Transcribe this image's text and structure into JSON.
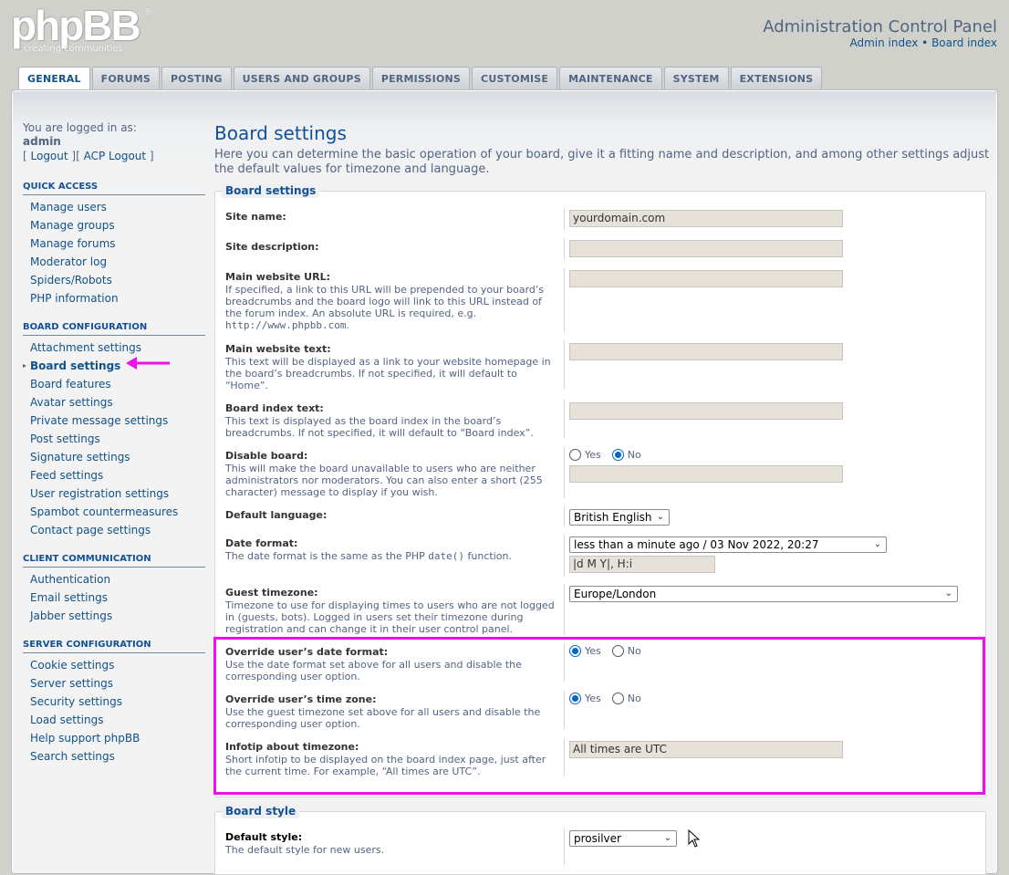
{
  "header": {
    "logo_text": "phpBB",
    "logo_tagline": "creating  communities",
    "logo_reg": "®",
    "title": "Administration Control Panel",
    "admin_index": "Admin index",
    "link_sep": "•",
    "board_index": "Board index"
  },
  "tabs": [
    {
      "label": "GENERAL",
      "active": true
    },
    {
      "label": "FORUMS"
    },
    {
      "label": "POSTING"
    },
    {
      "label": "USERS AND GROUPS"
    },
    {
      "label": "PERMISSIONS"
    },
    {
      "label": "CUSTOMISE"
    },
    {
      "label": "MAINTENANCE"
    },
    {
      "label": "SYSTEM"
    },
    {
      "label": "EXTENSIONS"
    }
  ],
  "sidebar": {
    "logged_in_label": "You are logged in as:",
    "username": "admin",
    "logout": "Logout",
    "acp_logout": "ACP Logout",
    "sections": [
      {
        "title": "QUICK ACCESS",
        "items": [
          "Manage users",
          "Manage groups",
          "Manage forums",
          "Moderator log",
          "Spiders/Robots",
          "PHP information"
        ]
      },
      {
        "title": "BOARD CONFIGURATION",
        "items": [
          "Attachment settings",
          "Board settings",
          "Board features",
          "Avatar settings",
          "Private message settings",
          "Post settings",
          "Signature settings",
          "Feed settings",
          "User registration settings",
          "Spambot countermeasures",
          "Contact page settings"
        ]
      },
      {
        "title": "CLIENT COMMUNICATION",
        "items": [
          "Authentication",
          "Email settings",
          "Jabber settings"
        ]
      },
      {
        "title": "SERVER CONFIGURATION",
        "items": [
          "Cookie settings",
          "Server settings",
          "Security settings",
          "Load settings",
          "Help support phpBB",
          "Search settings"
        ]
      }
    ],
    "active_item": "Board settings"
  },
  "main": {
    "title": "Board settings",
    "description": "Here you can determine the basic operation of your board, give it a fitting name and description, and among other settings adjust the default values for timezone and language.",
    "fieldset1_legend": "Board settings",
    "site_name_label": "Site name:",
    "site_name_value": "yourdomain.com",
    "site_desc_label": "Site description:",
    "site_desc_value": "",
    "main_url_label": "Main website URL:",
    "main_url_help": "If specified, a link to this URL will be prepended to your board’s breadcrumbs and the board logo will link to this URL instead of the forum index. An absolute URL is required, e.g.",
    "main_url_example": "http://www.phpbb.com",
    "main_url_value": "",
    "main_text_label": "Main website text:",
    "main_text_help": "This text will be displayed as a link to your website homepage in the board’s breadcrumbs. If not specified, it will default to “Home”.",
    "main_text_value": "",
    "index_text_label": "Board index text:",
    "index_text_help": "This text is displayed as the board index in the board’s breadcrumbs. If not specified, it will default to “Board index”.",
    "index_text_value": "",
    "disable_label": "Disable board:",
    "disable_help": "This will make the board unavailable to users who are neither administrators nor moderators. You can also enter a short (255 character) message to display if you wish.",
    "disable_value": "No",
    "disable_message": "",
    "lang_label": "Default language:",
    "lang_value": "British English",
    "date_label": "Date format:",
    "date_help_prefix": "The date format is the same as the PHP",
    "date_help_code": "date()",
    "date_help_suffix": "function.",
    "date_select": "less than a minute ago / 03 Nov 2022, 20:27",
    "date_custom": "|d M Y|, H:i",
    "tz_label": "Guest timezone:",
    "tz_help": "Timezone to use for displaying times to users who are not logged in (guests, bots). Logged in users set their timezone during registration and can change it in their user control panel.",
    "tz_value": "Europe/London",
    "override_date_label": "Override user’s date format:",
    "override_date_help": "Use the date format set above for all users and disable the corresponding user option.",
    "override_date_value": "Yes",
    "override_tz_label": "Override user’s time zone:",
    "override_tz_help": "Use the guest timezone set above for all users and disable the corresponding user option.",
    "override_tz_value": "Yes",
    "infotip_label": "Infotip about timezone:",
    "infotip_help": "Short infotip to be displayed on the board index page, just after the current time. For example, “All times are UTC”.",
    "infotip_value": "All times are UTC",
    "yes": "Yes",
    "no": "No",
    "fieldset2_legend": "Board style",
    "style_label": "Default style:",
    "style_help": "The default style for new users.",
    "style_value": "prosilver"
  },
  "annotation_color": "#ec11e8"
}
